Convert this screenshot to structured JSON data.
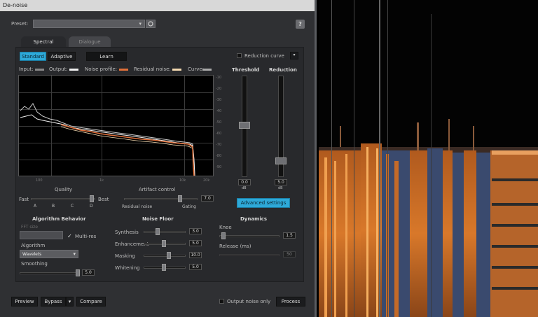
{
  "window": {
    "title": "De-noise"
  },
  "preset": {
    "label": "Preset:",
    "value": ""
  },
  "tabs": [
    {
      "label": "Spectral"
    },
    {
      "label": "Dialogue"
    }
  ],
  "mode_buttons": {
    "standard": "Standard",
    "adaptive": "Adaptive",
    "learn": "Learn"
  },
  "reduction_curve": {
    "label": "Reduction curve"
  },
  "legend": {
    "input": "Input:",
    "output": "Output:",
    "noise_profile": "Noise profile:",
    "residual_noise": "Residual noise:",
    "curve": "Curve:"
  },
  "graph": {
    "y_ticks": [
      "-10",
      "-20",
      "-30",
      "-40",
      "-50",
      "-60",
      "-70",
      "-80",
      "-90"
    ],
    "x_ticks": [
      "100",
      "1k",
      "10k",
      "20k"
    ]
  },
  "threshold": {
    "title": "Threshold",
    "value": "0.0",
    "unit": "dB"
  },
  "reduction": {
    "title": "Reduction",
    "value": "5.0",
    "unit": "dB"
  },
  "quality": {
    "title": "Quality",
    "left": "Fast",
    "right": "Best",
    "marks": [
      "A",
      "B",
      "C",
      "D"
    ]
  },
  "artifact_control": {
    "title": "Artifact control",
    "left": "Residual noise",
    "right": "Gating",
    "value": "7.0"
  },
  "advanced_settings": "Advanced settings",
  "algorithm_behavior": {
    "title": "Algorithm Behavior",
    "ft_size_label": "FFT size",
    "multi_res_label": "Multi-res",
    "algorithm_label": "Algorithm",
    "algorithm_value": "Wavelets",
    "smoothing_label": "Smoothing",
    "smoothing_value": "5.0"
  },
  "noise_floor": {
    "title": "Noise Floor",
    "rows": [
      {
        "label": "Synthesis",
        "value": "3.0"
      },
      {
        "label": "Enhancement",
        "value": "5.0"
      },
      {
        "label": "Masking",
        "value": "10.0"
      },
      {
        "label": "Whitening",
        "value": "5.0"
      }
    ]
  },
  "dynamics": {
    "title": "Dynamics",
    "knee_label": "Knee",
    "knee_value": "1.5",
    "release_label": "Release (ms)",
    "release_value": "50"
  },
  "footer": {
    "preview": "Preview",
    "bypass": "Bypass",
    "compare": "Compare",
    "output_noise_only": "Output noise only",
    "process": "Process"
  },
  "colors": {
    "accent": "#2ea9d8",
    "noise_profile": "#e0703a",
    "spectrogram_orange": "#d8782a",
    "spectrogram_blue": "#3a4a6e"
  }
}
